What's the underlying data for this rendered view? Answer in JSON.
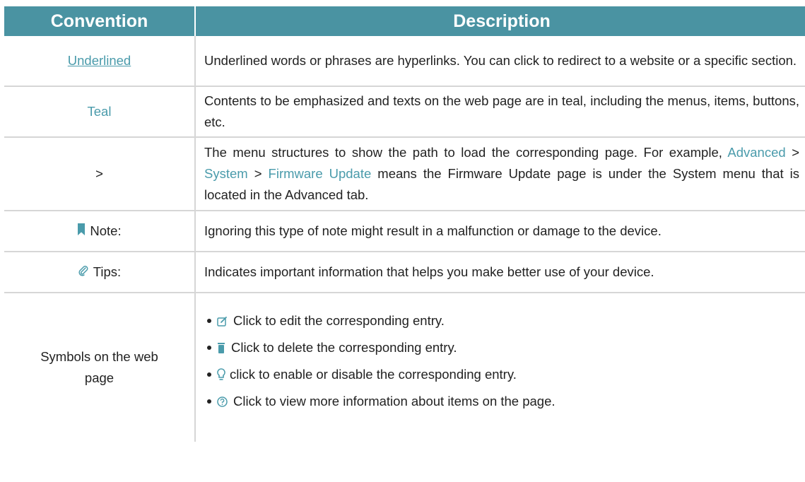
{
  "header": {
    "convention": "Convention",
    "description": "Description"
  },
  "rows": [
    {
      "convention": "Underlined",
      "description": "Underlined words or phrases are hyperlinks. You can click to redirect to a website or a specific section."
    },
    {
      "convention": "Teal",
      "description": "Contents to be emphasized and texts on the web page are in teal, including the menus, items, buttons, etc."
    },
    {
      "convention": ">",
      "description_pre": "The menu structures to show the path to load the corresponding page. For example, ",
      "path": [
        "Advanced",
        "System",
        "Firmware Update"
      ],
      "separator": ">",
      "description_post": " means the Firmware Update page is under the System menu that is located in the Advanced tab."
    },
    {
      "convention": "Note:",
      "icon": "bookmark-icon",
      "description": "Ignoring this type of note might result in a malfunction or damage to the device."
    },
    {
      "convention": "Tips:",
      "icon": "paperclip-icon",
      "description": "Indicates important information that helps you make better use of your device."
    },
    {
      "convention": "Symbols on the web page",
      "bullets": [
        {
          "icon": "edit-icon",
          "text": "Click to edit the corresponding entry."
        },
        {
          "icon": "trash-icon",
          "text": "Click to delete the corresponding entry."
        },
        {
          "icon": "lightbulb-icon",
          "text": "click to enable or disable the corresponding entry."
        },
        {
          "icon": "help-circle-icon",
          "text": "Click to view more information about items on the page."
        }
      ]
    }
  ],
  "colors": {
    "header_bg": "#4a93a2",
    "teal": "#4a9bab",
    "border": "#d6d6d6",
    "text": "#222222"
  }
}
